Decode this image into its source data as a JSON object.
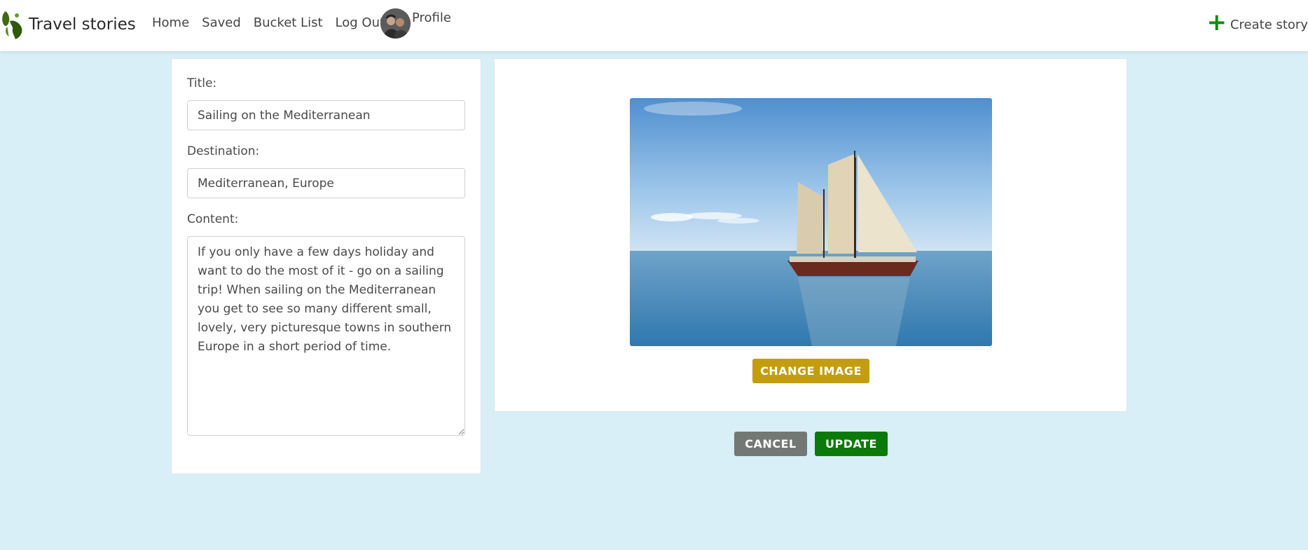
{
  "navbar": {
    "brand": "Travel stories",
    "links": [
      "Home",
      "Saved",
      "Bucket List",
      "Log Out"
    ],
    "profile_label": "Profile",
    "create_label": "Create story"
  },
  "form": {
    "title_label": "Title:",
    "title_value": "Sailing on the Mediterranean",
    "destination_label": "Destination:",
    "destination_value": "Mediterranean, Europe",
    "content_label": "Content:",
    "content_value": "If you only have a few days holiday and want to do the most of it - go on a sailing trip! When sailing on the Mediterranean you get to see so many different small, lovely, very picturesque towns in southern Europe in a short period of time."
  },
  "image_panel": {
    "change_image_label": "CHANGE IMAGE"
  },
  "actions": {
    "cancel_label": "CANCEL",
    "update_label": "UPDATE"
  },
  "colors": {
    "page_bg": "#d8eff8",
    "accent_green": "#0b7a0b",
    "change_button": "#c39d0e",
    "cancel_button": "#737874"
  },
  "icons": {
    "logo": "globe-icon",
    "create": "plus-icon"
  }
}
